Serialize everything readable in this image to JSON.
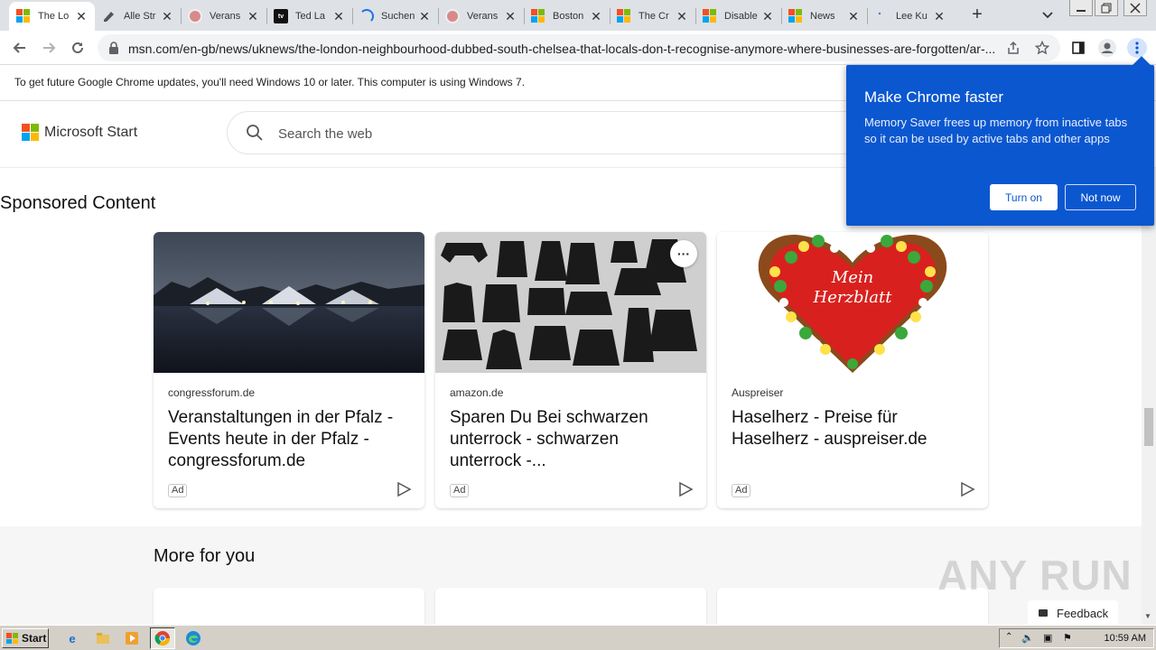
{
  "browser": {
    "tabs": [
      {
        "title": "The Lo",
        "favicon": "microsoft-icon",
        "active": true
      },
      {
        "title": "Alle Str",
        "favicon": "pen-icon"
      },
      {
        "title": "Verans",
        "favicon": "globe-icon"
      },
      {
        "title": "Ted La",
        "favicon": "appletv-icon"
      },
      {
        "title": "Suchen",
        "favicon": "loading-spinner-icon"
      },
      {
        "title": "Verans",
        "favicon": "globe-icon"
      },
      {
        "title": "Boston",
        "favicon": "microsoft-icon"
      },
      {
        "title": "The Cr",
        "favicon": "microsoft-icon"
      },
      {
        "title": "Disable",
        "favicon": "microsoft-icon"
      },
      {
        "title": "News",
        "favicon": "microsoft-icon"
      },
      {
        "title": "Lee Ku",
        "favicon": "dot-icon"
      }
    ],
    "new_tab_icon": "plus-icon",
    "tab_list_icon": "chevron-down-icon",
    "url": "msn.com/en-gb/news/uknews/the-london-neighbourhood-dubbed-south-chelsea-that-locals-don-t-recognise-anymore-where-businesses-are-forgotten/ar-..."
  },
  "infobar": {
    "message": "To get future Google Chrome updates, you'll need Windows 10 or later. This computer is using Windows 7."
  },
  "msn": {
    "brand": "Microsoft Start",
    "search_placeholder": "Search the web"
  },
  "sponsored": {
    "title": "Sponsored Content",
    "ad_label": "Ad",
    "cards": [
      {
        "source": "congressforum.de",
        "headline": "Veranstaltungen in der Pfalz - Events heute in der Pfalz - congressforum.de"
      },
      {
        "source": "amazon.de",
        "headline": "Sparen Du Bei schwarzen unterrock - schwarzen unterrock -..."
      },
      {
        "source": "Auspreiser",
        "headline": "Haselherz - Preise für Haselherz - auspreiser.de",
        "image_text": "Mein Herzblatt"
      }
    ]
  },
  "more_for_you": {
    "title": "More for you"
  },
  "feedback": {
    "label": "Feedback"
  },
  "watermark": {
    "text": "ANY RUN"
  },
  "popup": {
    "title": "Make Chrome faster",
    "body": "Memory Saver frees up memory from inactive tabs so it can be used by active tabs and other apps",
    "primary": "Turn on",
    "secondary": "Not now",
    "color": "#0b57d0"
  },
  "taskbar": {
    "start": "Start",
    "clock": "10:59 AM"
  }
}
